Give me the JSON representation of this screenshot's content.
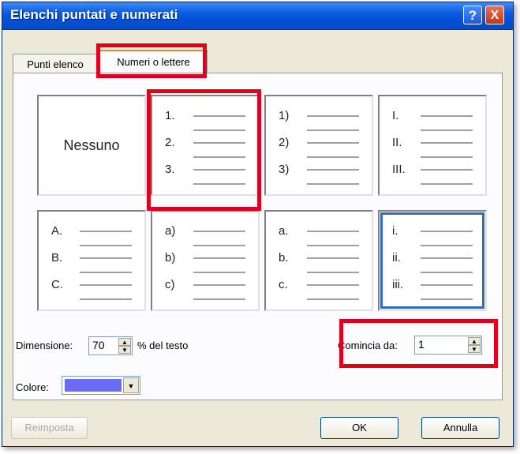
{
  "window": {
    "title": "Elenchi puntati e numerati"
  },
  "tabs": [
    {
      "label": "Punti elenco"
    },
    {
      "label": "Numeri o lettere"
    }
  ],
  "styles": {
    "none_label": "Nessuno",
    "rows": [
      [
        [
          "1.",
          "2.",
          "3."
        ],
        [
          "1)",
          "2)",
          "3)"
        ],
        [
          "I.",
          "II.",
          "III."
        ]
      ],
      [
        [
          "A.",
          "B.",
          "C."
        ],
        [
          "a)",
          "b)",
          "c)"
        ],
        [
          "a.",
          "b.",
          "c."
        ],
        [
          "i.",
          "ii.",
          "iii."
        ]
      ]
    ]
  },
  "size": {
    "label": "Dimensione:",
    "value": "70",
    "suffix": "% del testo"
  },
  "start": {
    "label": "Comincia da:",
    "value": "1"
  },
  "color": {
    "label": "Colore:",
    "swatch": "#6b6bf5"
  },
  "buttons": {
    "reset": "Reimposta",
    "ok": "OK",
    "cancel": "Annulla"
  },
  "icons": {
    "help": "?",
    "close": "X",
    "up": "▲",
    "down": "▼"
  }
}
